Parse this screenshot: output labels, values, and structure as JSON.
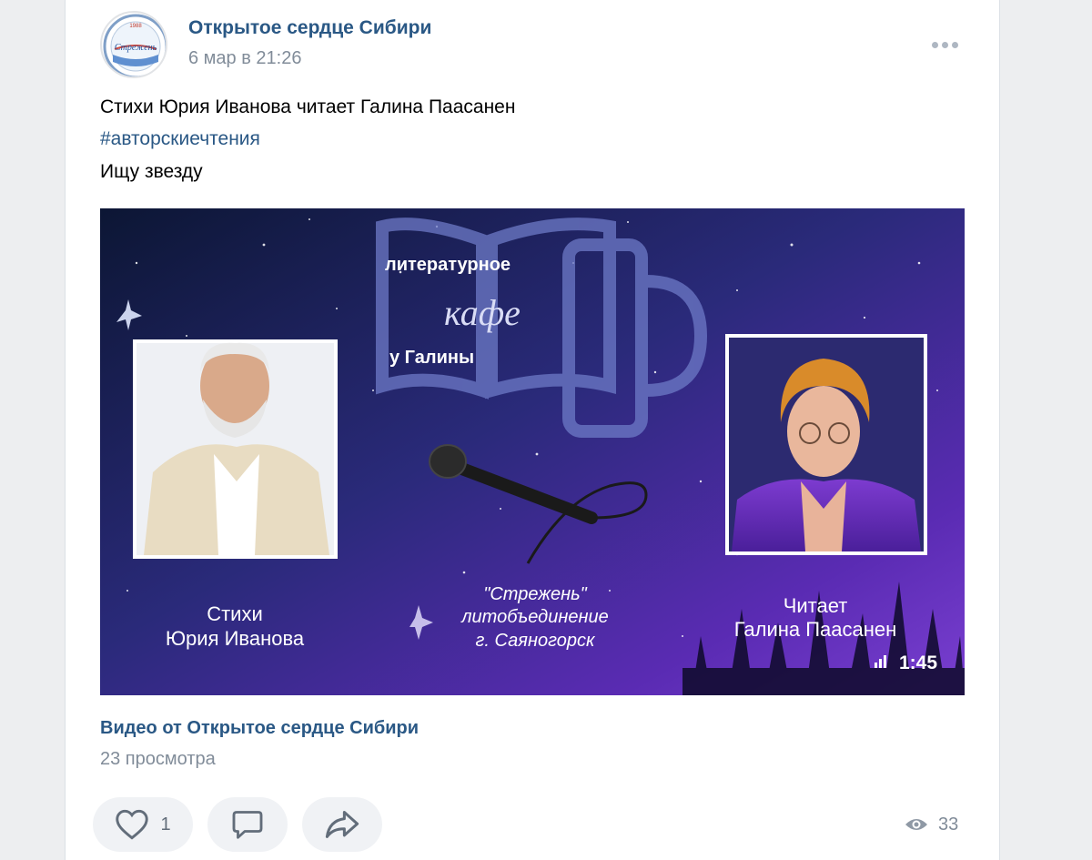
{
  "post": {
    "author": "Открытое сердце Сибири",
    "date": "6 мар в 21:26",
    "avatar_text": "Стрежень",
    "avatar_top": "1988",
    "text_line1": "Стихи Юрия Иванова читает Галина Паасанен",
    "hashtag": "#авторскиечтения",
    "text_line3": "Ищу звезду"
  },
  "video": {
    "poster": {
      "logo_top": "литературное",
      "logo_mid": "кафе",
      "logo_bottom": "у Галины",
      "left_caption_1": "Стихи",
      "left_caption_2": "Юрия Иванова",
      "center_caption_1": "\"Стрежень\"",
      "center_caption_2": "литобъединение",
      "center_caption_3": "г. Саяногорск",
      "right_caption_1": "Читает",
      "right_caption_2": "Галина Паасанен"
    },
    "duration": "1:45",
    "title": "Видео от Открытое сердце Сибири",
    "views": "23 просмотра"
  },
  "actions": {
    "likes": "1",
    "view_count": "33"
  },
  "icons": {
    "more": "more-horizontal-icon",
    "like": "heart-icon",
    "comment": "comment-icon",
    "share": "share-icon",
    "views": "eye-icon",
    "quality": "signal-bars-icon"
  },
  "colors": {
    "link": "#2a5885",
    "secondary": "#818c99",
    "background": "#edeef0"
  }
}
